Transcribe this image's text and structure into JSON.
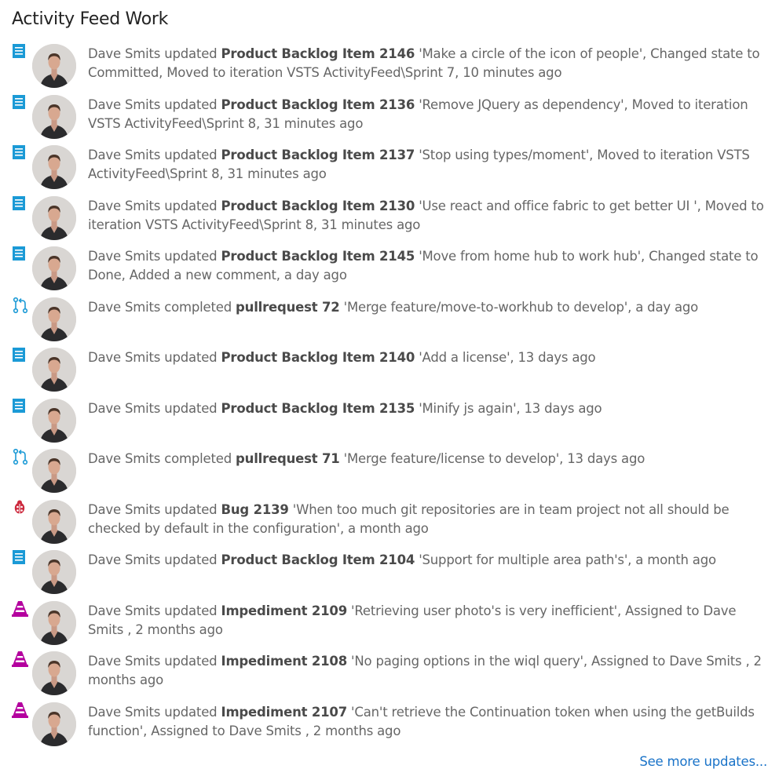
{
  "page": {
    "title": "Activity Feed Work"
  },
  "colors": {
    "pbi": "#1b9ad6",
    "pr": "#1b9ad6",
    "bug": "#cc293d",
    "impediment": "#b4009e",
    "link": "#1a73c8"
  },
  "feed": {
    "items": [
      {
        "icon": "backlog-item-icon",
        "user": "Dave Smits",
        "action": "updated",
        "item": "Product Backlog Item 2146",
        "rest": "'Make a circle of the icon of people', Changed state to Committed, Moved to iteration VSTS ActivityFeed\\Sprint 7, 10 minutes ago"
      },
      {
        "icon": "backlog-item-icon",
        "user": "Dave Smits",
        "action": "updated",
        "item": "Product Backlog Item 2136",
        "rest": "'Remove JQuery as dependency', Moved to iteration VSTS ActivityFeed\\Sprint 8, 31 minutes ago"
      },
      {
        "icon": "backlog-item-icon",
        "user": "Dave Smits",
        "action": "updated",
        "item": "Product Backlog Item 2137",
        "rest": "'Stop using types/moment', Moved to iteration VSTS ActivityFeed\\Sprint 8, 31 minutes ago"
      },
      {
        "icon": "backlog-item-icon",
        "user": "Dave Smits",
        "action": "updated",
        "item": "Product Backlog Item 2130",
        "rest": "'Use react and office fabric to get better UI ', Moved to iteration VSTS ActivityFeed\\Sprint 8, 31 minutes ago"
      },
      {
        "icon": "backlog-item-icon",
        "user": "Dave Smits",
        "action": "updated",
        "item": "Product Backlog Item 2145",
        "rest": "'Move from home hub to work hub', Changed state to Done, Added a new comment, a day ago"
      },
      {
        "icon": "pull-request-icon",
        "user": "Dave Smits",
        "action": "completed",
        "item": "pullrequest 72",
        "rest": "'Merge feature/move-to-workhub to develop', a day ago"
      },
      {
        "icon": "backlog-item-icon",
        "user": "Dave Smits",
        "action": "updated",
        "item": "Product Backlog Item 2140",
        "rest": "'Add a license', 13 days ago"
      },
      {
        "icon": "backlog-item-icon",
        "user": "Dave Smits",
        "action": "updated",
        "item": "Product Backlog Item 2135",
        "rest": "'Minify js again', 13 days ago"
      },
      {
        "icon": "pull-request-icon",
        "user": "Dave Smits",
        "action": "completed",
        "item": "pullrequest 71",
        "rest": "'Merge feature/license to develop', 13 days ago"
      },
      {
        "icon": "bug-icon",
        "user": "Dave Smits",
        "action": "updated",
        "item": "Bug 2139",
        "rest": "'When too much git repositories are in team project not all should be checked by default in the configuration', a month ago"
      },
      {
        "icon": "backlog-item-icon",
        "user": "Dave Smits",
        "action": "updated",
        "item": "Product Backlog Item 2104",
        "rest": "'Support for multiple area path's', a month ago"
      },
      {
        "icon": "impediment-icon",
        "user": "Dave Smits",
        "action": "updated",
        "item": "Impediment 2109",
        "rest": "'Retrieving user photo's is very inefficient', Assigned to Dave Smits , 2 months ago"
      },
      {
        "icon": "impediment-icon",
        "user": "Dave Smits",
        "action": "updated",
        "item": "Impediment 2108",
        "rest": "'No paging options in the wiql query', Assigned to Dave Smits , 2 months ago"
      },
      {
        "icon": "impediment-icon",
        "user": "Dave Smits",
        "action": "updated",
        "item": "Impediment 2107",
        "rest": "'Can't retrieve the Continuation token when using the getBuilds function', Assigned to Dave Smits , 2 months ago"
      }
    ]
  },
  "footer": {
    "see_more_label": "See more updates..."
  }
}
